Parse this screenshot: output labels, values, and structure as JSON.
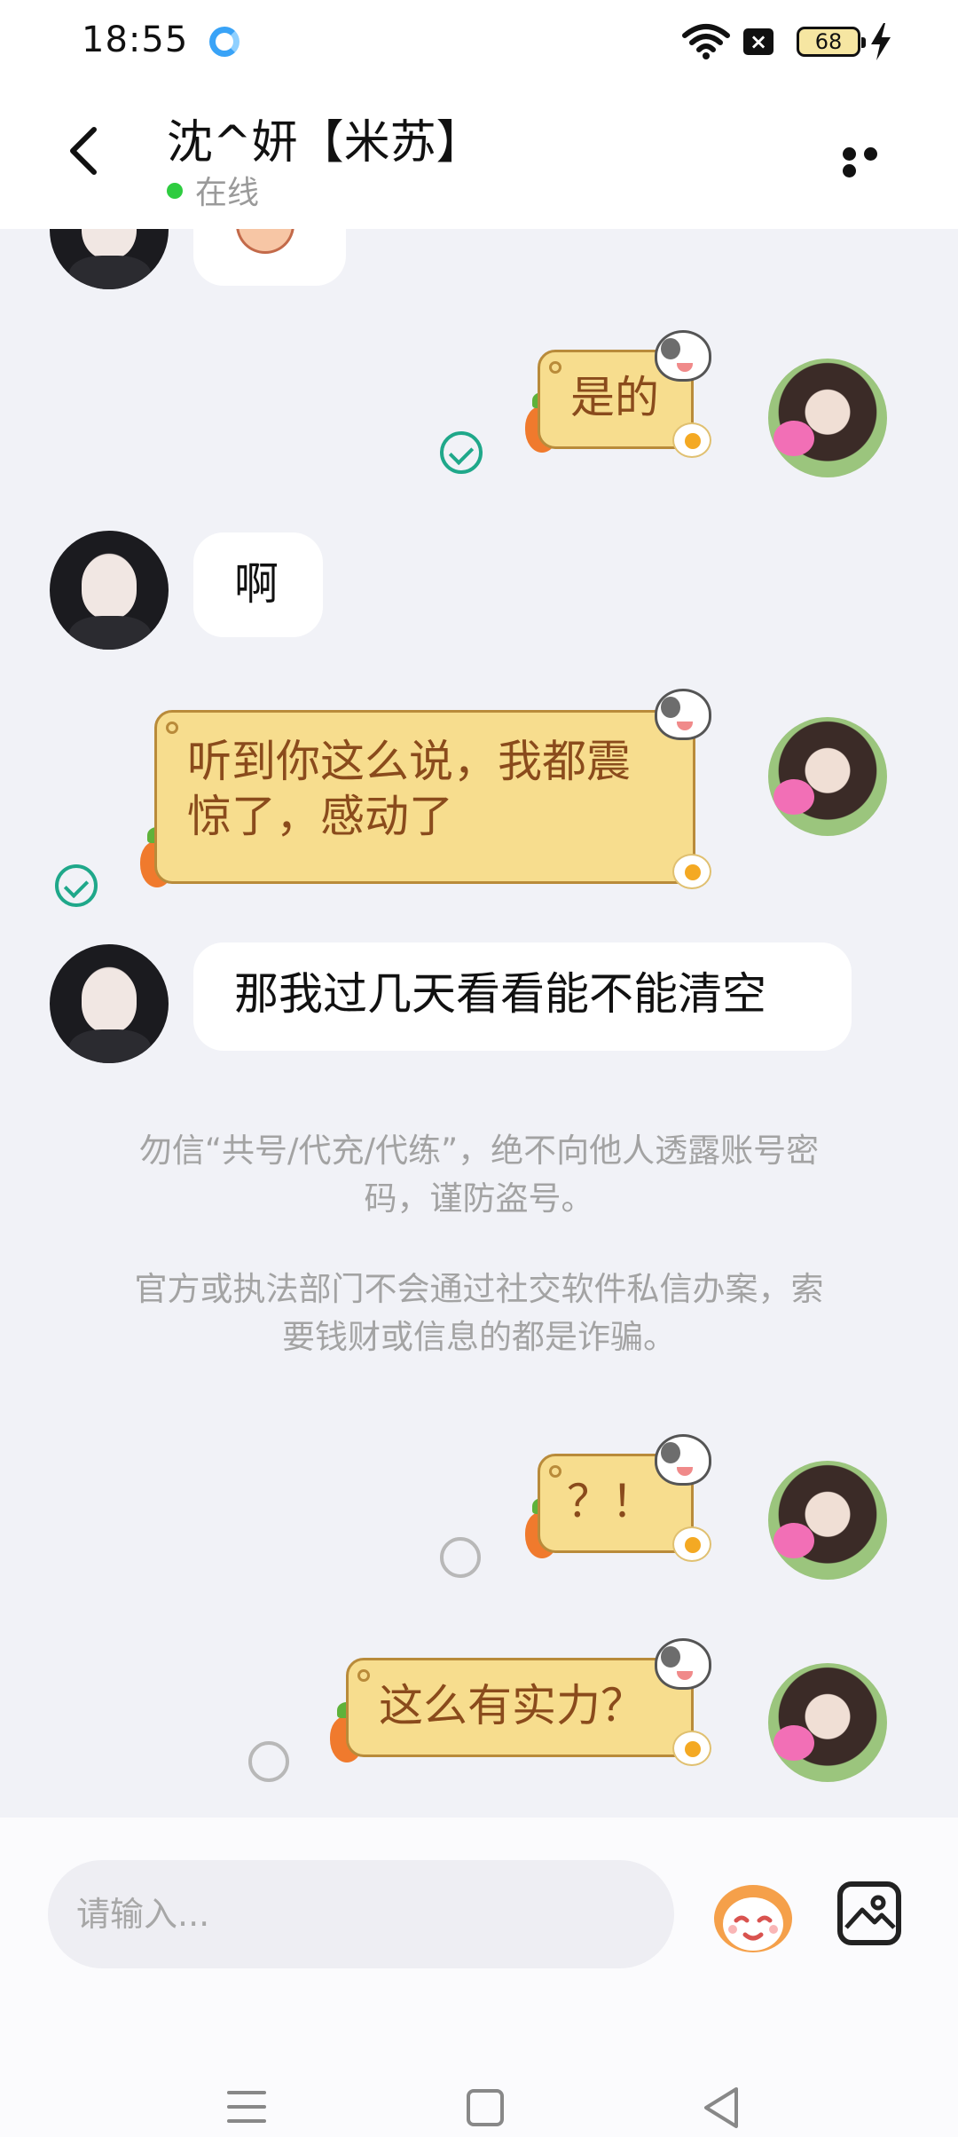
{
  "status_bar": {
    "time": "18:55",
    "battery": "68",
    "icons": [
      "q-app-icon",
      "wifi-icon",
      "x-icon",
      "battery-icon",
      "charging-bolt-icon"
    ]
  },
  "header": {
    "title": "沈^妍【米苏】",
    "status": "在线",
    "status_color": "#2ecc40",
    "back_icon": "chevron-left-icon",
    "more_icon": "ellipsis-icon"
  },
  "messages": [
    {
      "side": "right",
      "text": "是的",
      "state": "read"
    },
    {
      "side": "left",
      "text": "啊"
    },
    {
      "side": "right",
      "text_lines": [
        "听到你这么说，我都震",
        "惊了，感动了"
      ],
      "state": "read"
    },
    {
      "side": "left",
      "text": "那我过几天看看能不能清空"
    },
    {
      "side": "right",
      "text": "？！",
      "state": "pending"
    },
    {
      "side": "right",
      "text": "这么有实力？",
      "state": "pending"
    }
  ],
  "notices": {
    "first_lines": [
      "勿信“共号/代充/代练”，绝不向他人透露账号密",
      "码，谨防盗号。"
    ],
    "second_lines": [
      "官方或执法部门不会通过社交软件私信办案，索",
      "要钱财或信息的都是诈骗。"
    ]
  },
  "input_bar": {
    "placeholder": "请输入...",
    "emoji_icon": "emoji-face-icon",
    "image_icon": "image-icon"
  },
  "colors": {
    "bubble_yellow": "#f7dd8e",
    "bubble_text": "#8a4b1c",
    "read_check": "#1fa88a"
  }
}
